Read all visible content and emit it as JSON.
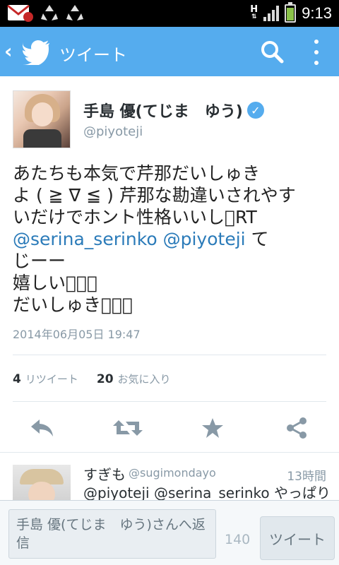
{
  "status_bar": {
    "time": "9:13",
    "network": "H",
    "icons": [
      "gmail-icon",
      "recycle-icon",
      "recycle-icon",
      "signal-icon",
      "battery-icon"
    ]
  },
  "app_bar": {
    "title": "ツイート",
    "back_glyph": "‹",
    "color": "#55acee"
  },
  "tweet": {
    "author": {
      "display_name": "手島 優(てじま　ゆう)",
      "handle": "@piyoteji",
      "verified": true
    },
    "text_lines": [
      {
        "parts": [
          {
            "text": "あたちも本気で芹那だいしゅき"
          }
        ]
      },
      {
        "parts": [
          {
            "text": "よ ( ≧ ∇ ≦ ) 芹那な勘違いされやす"
          }
        ]
      },
      {
        "parts": [
          {
            "text": "いだけでホント性格いいし\u0000RT"
          }
        ]
      },
      {
        "parts": [
          {
            "text": "@serina_serinko",
            "mention": true
          },
          {
            "text": " "
          },
          {
            "text": "@piyoteji",
            "mention": true
          },
          {
            "text": " て"
          }
        ]
      },
      {
        "parts": [
          {
            "text": "じーー"
          }
        ]
      },
      {
        "parts": [
          {
            "text": "嬉しい\u0000\u0000\u0000"
          }
        ]
      },
      {
        "parts": [
          {
            "text": "だいしゅき\u0000\u0000\u0000"
          }
        ]
      }
    ],
    "timestamp": "2014年06月05日 19:47",
    "retweets": {
      "count": "4",
      "label": "リツイート"
    },
    "favorites": {
      "count": "20",
      "label": "お気に入り"
    }
  },
  "reply_preview": {
    "name": "すぎも",
    "handle": "@sugimondayo",
    "time": "13時間",
    "text": "@piyoteji @serina_serinko やっぱり"
  },
  "compose": {
    "placeholder": "手島 優(てじま　ゆう)さんへ返信",
    "char_count": "140",
    "button_label": "ツイート"
  }
}
